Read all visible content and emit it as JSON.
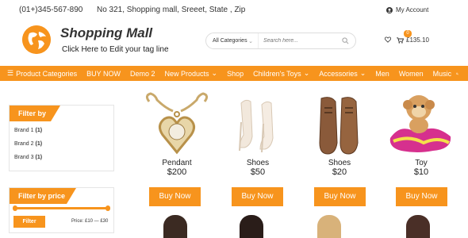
{
  "topbar": {
    "phone": "(01+)345-567-890",
    "address": "No 321, Shopping mall, Sreeet, State , Zip",
    "account_label": "My Account"
  },
  "header": {
    "site_title": "Shopping Mall",
    "tagline": "Click Here to Edit your tag line",
    "search": {
      "category": "All Categories",
      "placeholder": "Search here..."
    },
    "cart": {
      "count": "0",
      "total": "£135.10"
    }
  },
  "nav": {
    "items": [
      {
        "label": "Product Categories",
        "has_dropdown": false,
        "icon": "menu-icon"
      },
      {
        "label": "BUY NOW",
        "has_dropdown": false
      },
      {
        "label": "Demo 2",
        "has_dropdown": false
      },
      {
        "label": "New Products",
        "has_dropdown": true
      },
      {
        "label": "Shop",
        "has_dropdown": false
      },
      {
        "label": "Children's Toys",
        "has_dropdown": true
      },
      {
        "label": "Accessories",
        "has_dropdown": true
      },
      {
        "label": "Men",
        "has_dropdown": false
      },
      {
        "label": "Women",
        "has_dropdown": false
      },
      {
        "label": "Music",
        "has_dropdown": false
      }
    ]
  },
  "sidebar": {
    "filter_by": {
      "title": "Filter by",
      "brands": [
        {
          "label": "Brand 1",
          "count": "(1)"
        },
        {
          "label": "Brand 2",
          "count": "(1)"
        },
        {
          "label": "Brand 3",
          "count": "(1)"
        }
      ]
    },
    "filter_price": {
      "title": "Filter by price",
      "button": "Filter",
      "range": "Price: £10 — £30"
    }
  },
  "products": [
    {
      "name": "Pendant",
      "price": "$200",
      "button": "Buy Now"
    },
    {
      "name": "Shoes",
      "price": "$50",
      "button": "Buy Now"
    },
    {
      "name": "Shoes",
      "price": "$20",
      "button": "Buy Now"
    },
    {
      "name": "Toy",
      "price": "$10",
      "button": "Buy Now"
    }
  ],
  "colors": {
    "accent": "#f7941d"
  }
}
